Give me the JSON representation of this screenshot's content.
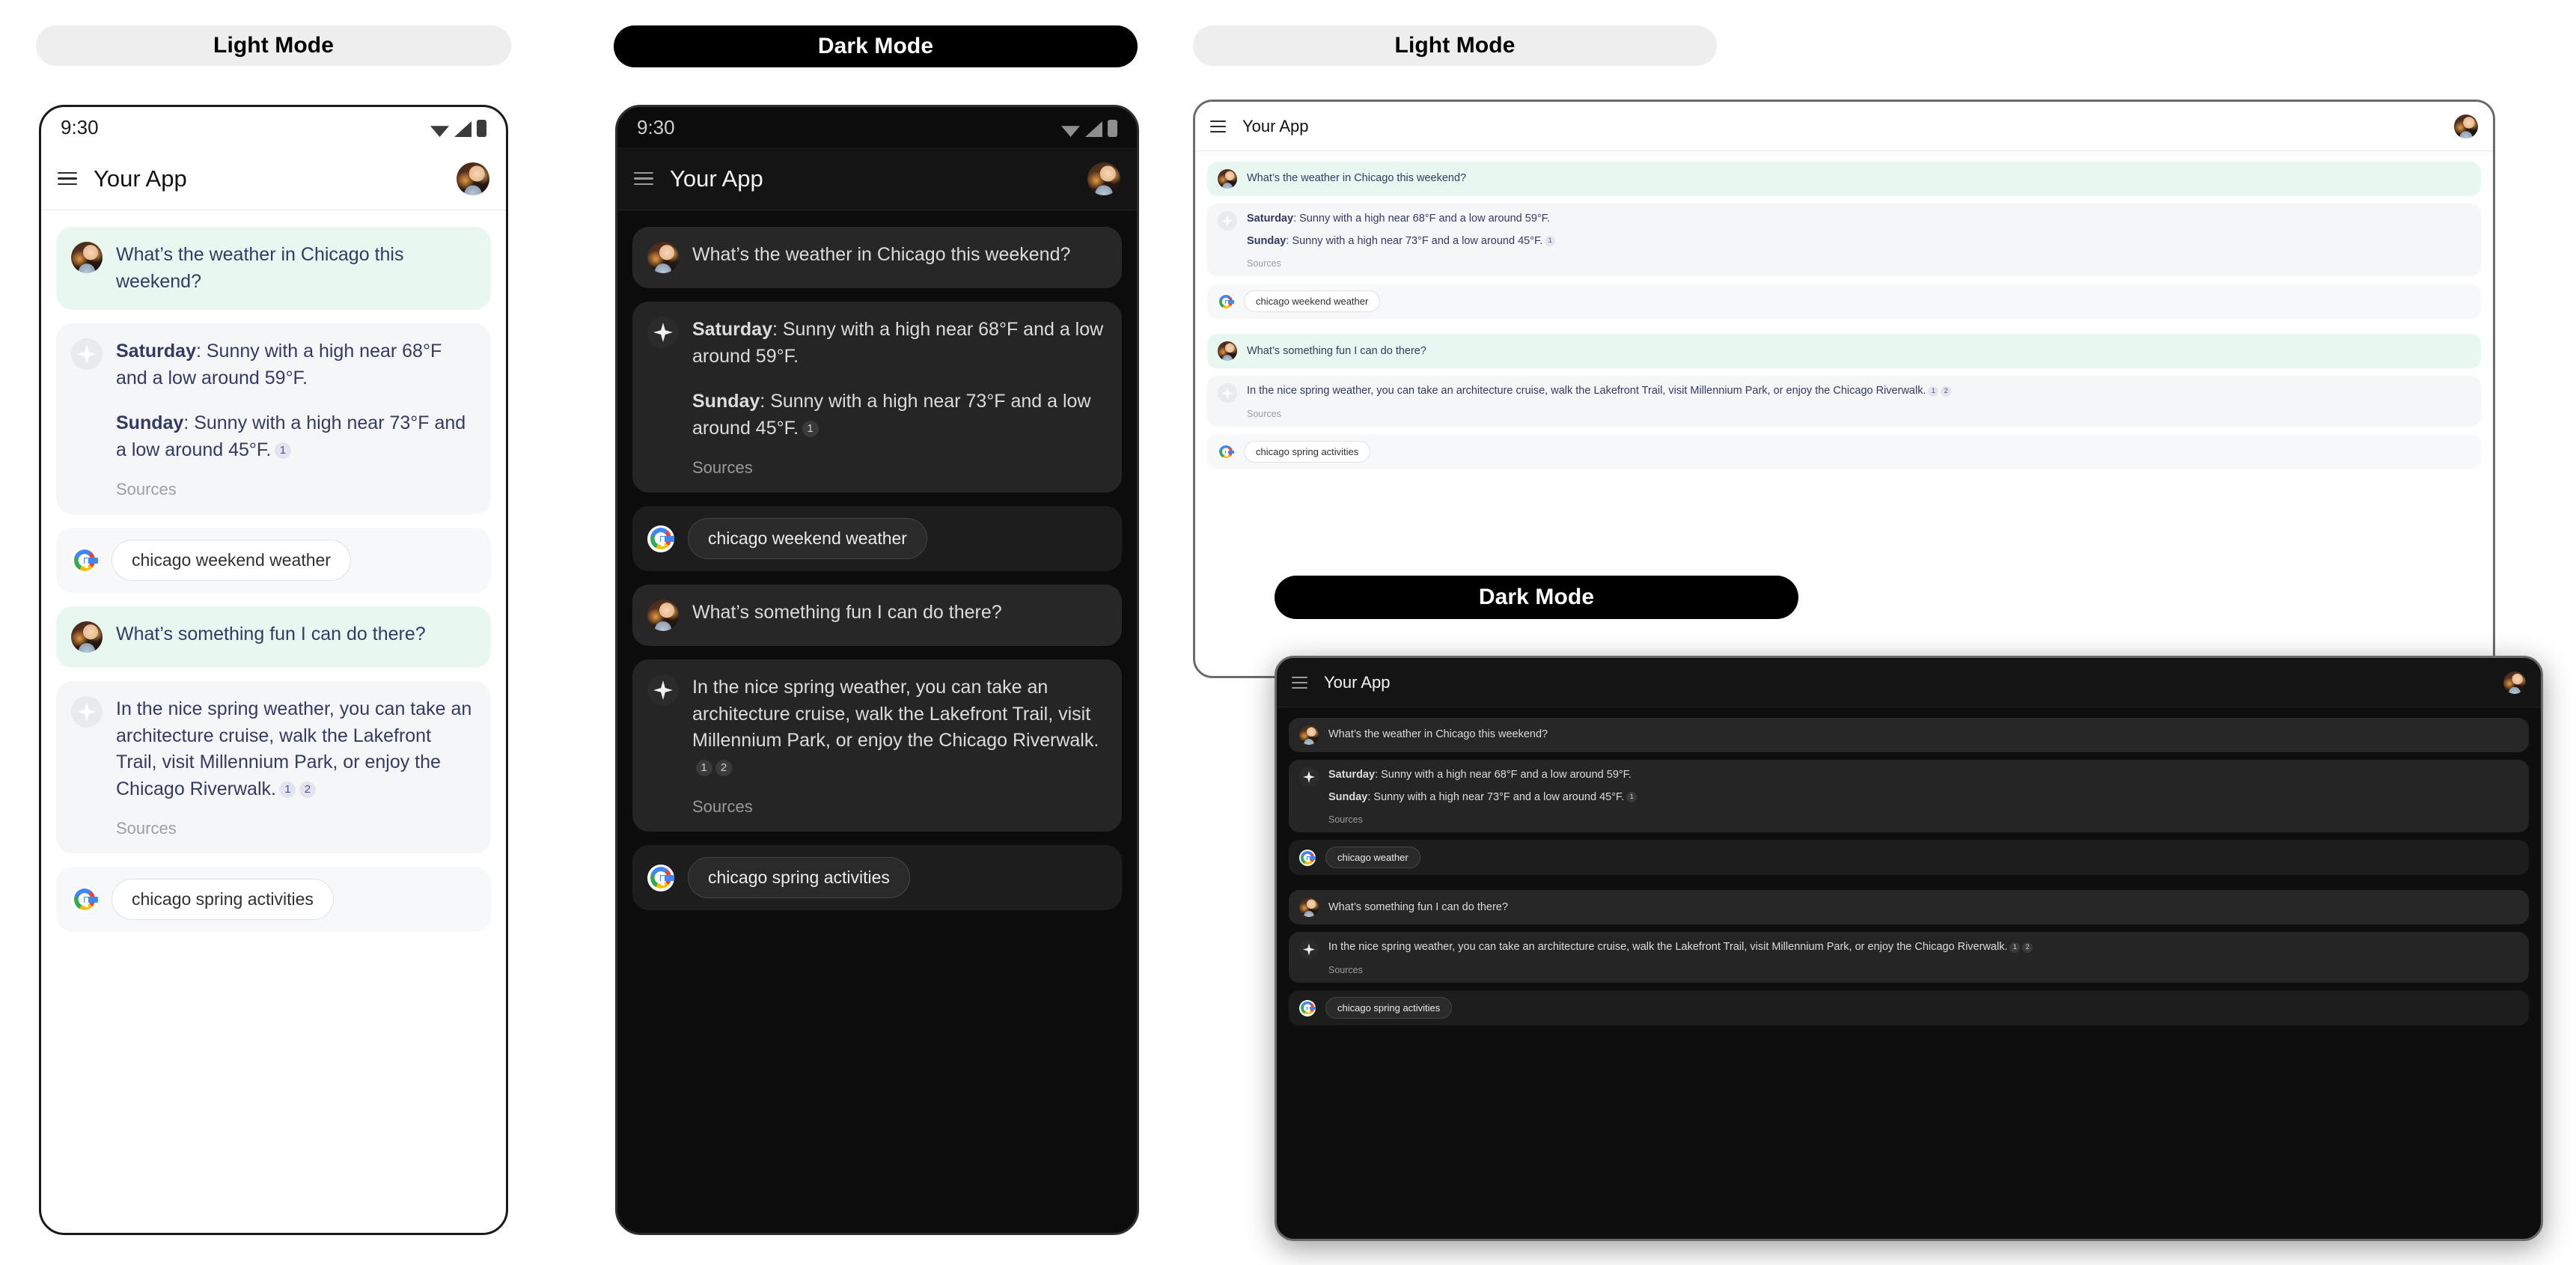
{
  "labels": {
    "light_mode": "Light Mode",
    "dark_mode": "Dark Mode"
  },
  "panels": {
    "phone_light": {
      "mode_label": "Light Mode",
      "status": {
        "clock": "9:30",
        "icons": [
          "wifi-icon",
          "cellular-icon",
          "battery-icon"
        ]
      },
      "appbar": {
        "menu_icon": "hamburger-menu-icon",
        "title": "Your App",
        "avatar": "user-avatar"
      }
    },
    "phone_dark": {
      "mode_label": "Dark Mode",
      "status": {
        "clock": "9:30",
        "icons": [
          "wifi-icon",
          "cellular-icon",
          "battery-icon"
        ]
      },
      "appbar": {
        "menu_icon": "hamburger-menu-icon",
        "title": "Your App",
        "avatar": "user-avatar"
      }
    },
    "tablet_light": {
      "mode_label": "Light Mode",
      "appbar": {
        "menu_icon": "hamburger-menu-icon",
        "title": "Your App",
        "avatar": "user-avatar"
      }
    },
    "tablet_dark": {
      "mode_label": "Dark Mode",
      "appbar": {
        "menu_icon": "hamburger-menu-icon",
        "title": "Your App",
        "avatar": "user-avatar"
      }
    }
  },
  "conversation": {
    "q1": "What’s the weather in Chicago this weekend?",
    "a1_saturday_label": "Saturday",
    "a1_saturday_text": ": Sunny with a high near 68°F and a low around 59°F.",
    "a1_sunday_label": "Sunday",
    "a1_sunday_text": ": Sunny with a high near 73°F and a low around 45°F.",
    "a1_cite_1": "1",
    "sources_label": "Sources",
    "chip1_query": "chicago weekend weather",
    "chip1_query_short": "chicago weather",
    "q2": "What’s something fun I can do there?",
    "a2_text": "In the nice spring weather, you can take an architecture cruise, walk the Lakefront Trail, visit Millennium Park, or enjoy the Chicago Riverwalk.",
    "a2_cite_1": "1",
    "a2_cite_2": "2",
    "chip2_query": "chicago spring activities",
    "search_provider_icon": "google-g-icon",
    "assistant_icon": "gemini-sparkle-icon"
  },
  "colors": {
    "user_bubble_light": "#e8f8f1",
    "ai_bubble_light": "#f5f6f8",
    "text_light": "#343a63",
    "user_bubble_dark": "#272727",
    "ai_bubble_dark": "#252525",
    "text_dark": "#dcdcdc",
    "pill_light_bg": "#eeeeee",
    "pill_dark_bg": "#000000"
  }
}
